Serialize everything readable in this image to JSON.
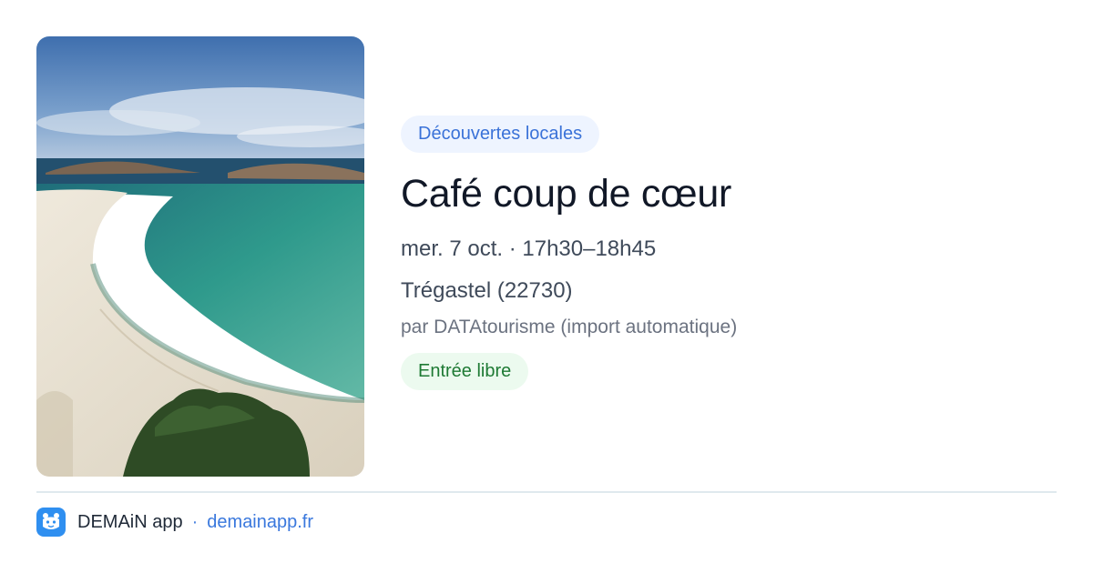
{
  "photo": {
    "icon": "beach-photo"
  },
  "event": {
    "category": "Découvertes locales",
    "title": "Café coup de cœur",
    "datetime": "mer. 7 oct. · 17h30–18h45",
    "location": "Trégastel (22730)",
    "source": "par DATAtourisme (import automatique)",
    "price": "Entrée libre"
  },
  "footer": {
    "app_name": "DEMAiN app",
    "separator": "·",
    "link": "demainapp.fr",
    "icon": "demain-logo-icon"
  },
  "colors": {
    "category_pill_bg": "#eef4ff",
    "category_text": "#3a72d8",
    "price_pill_bg": "#ecfaef",
    "price_text": "#1e7a34",
    "link": "#3a78dd",
    "app_icon_bg": "#2f8ff0"
  }
}
